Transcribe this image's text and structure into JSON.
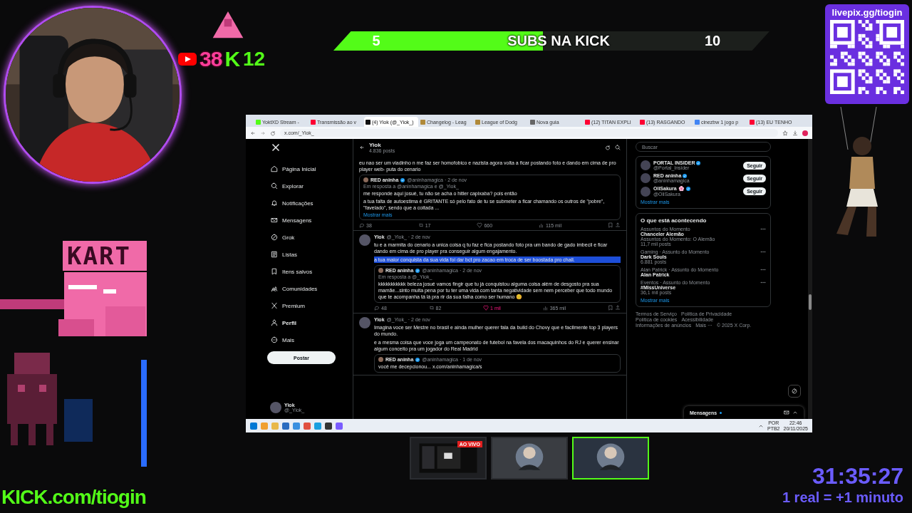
{
  "stream_overlay": {
    "youtube_counter": {
      "count": "38",
      "suffix": "K",
      "delta": "12"
    },
    "sub_goal": {
      "current": "5",
      "label": "SUBS NA KICK",
      "target": "10",
      "level": 0.48
    },
    "donation": {
      "url": "livepix.gg/tiogin"
    },
    "sign": "KART",
    "channel_url": "KICK.com/tiogin",
    "timer": "31:35:27",
    "timer_rule": "1 real = +1 minuto",
    "scenes": [
      {
        "kind": "screen",
        "badge": "AO VIVO",
        "selected": false
      },
      {
        "kind": "avatar",
        "selected": false
      },
      {
        "kind": "avatar",
        "selected": true
      }
    ]
  },
  "browser": {
    "tabs": [
      {
        "kind": "kick",
        "title": "YoktXD Stream -",
        "selected": false
      },
      {
        "kind": "youtube",
        "title": "Transmissão ao v",
        "selected": false
      },
      {
        "kind": "x",
        "title": "(4) Yiok (@_Yiok_)",
        "selected": true
      },
      {
        "kind": "game",
        "title": "Changelog - Leag",
        "selected": false
      },
      {
        "kind": "game",
        "title": "League of Dodg",
        "selected": false
      },
      {
        "kind": "globe",
        "title": "Nova guia",
        "selected": false
      },
      {
        "kind": "youtube",
        "title": "(12) TITAN EXPLI",
        "selected": false
      },
      {
        "kind": "youtube",
        "title": "(13) RASGANDO",
        "selected": false
      },
      {
        "kind": "google",
        "title": "cinezbw 1 jogo p",
        "selected": false
      },
      {
        "kind": "youtube",
        "title": "(13) EU TENHO",
        "selected": false
      }
    ],
    "address": "x.com/_Yiok_",
    "nav": [
      {
        "kind": "home",
        "label": "Página Inicial",
        "selected": false
      },
      {
        "kind": "search",
        "label": "Explorar",
        "selected": false
      },
      {
        "kind": "bell",
        "label": "Notificações",
        "selected": false
      },
      {
        "kind": "mail",
        "label": "Mensagens",
        "selected": false
      },
      {
        "kind": "grok",
        "label": "Grok",
        "selected": false
      },
      {
        "kind": "list",
        "label": "Listas",
        "selected": false
      },
      {
        "kind": "bookmark",
        "label": "Itens salvos",
        "selected": false
      },
      {
        "kind": "people",
        "label": "Comunidades",
        "selected": false
      },
      {
        "kind": "x",
        "label": "Premium",
        "selected": false
      },
      {
        "kind": "person",
        "label": "Perfil",
        "selected": true
      },
      {
        "kind": "more",
        "label": "Mais",
        "selected": false
      }
    ],
    "post_button": "Postar",
    "account": {
      "name": "Yiok",
      "handle": "@_Yiok_"
    },
    "profile_header": {
      "name": "Yiok",
      "posts": "4.836 posts"
    },
    "tweets": [
      {
        "paragraphs": [
          "eu nao ser um viadinho n me faz ser homofobico e nazista agora volta a ficar postando foto e dando em cima de pro player web- puta do cenario"
        ],
        "quote": {
          "author": "RED aninha",
          "meta": "@aninhamagica · 2 de nov",
          "reply_to": "Em resposta a @aninhamagica e @_Yiok_",
          "paragraphs": [
            "me responde aqui josué, tu não se acha o hitler capixaba? pois então",
            "a tua falta de autoestima é GRITANTE só pelo fato de tu se submeter a ficar chamando os outros de \"pobre\", \"favelado\", sendo que a coitada ..."
          ],
          "more": "Mostrar mais"
        },
        "stats": {
          "replies": "38",
          "reposts": "17",
          "likes": "660",
          "views": "115 mil",
          "liked": false
        }
      },
      {
        "author": "Yiok",
        "meta": "@_Yiok_ · 2 de nov",
        "paragraphs": [
          "tu e a marmita do cenario a unica coisa q tu faz e fica postando foto pra um bando de gado imbecil e ficar dando em cima de pro player pra conseguir algum engajamento.",
          "a tua maior conquista da sua vida foi dar  bct pro zacao em troca de ser boostada pro chall."
        ],
        "quote": {
          "author": "RED aninha",
          "meta": "@aninhamagica · 2 de nov",
          "reply_to": "Em resposta a @_Yiok_",
          "paragraphs": [
            "kkkkkkkkkkk beleza josué vamos fingir que tu já conquistou alguma coisa além de desgosto pra sua mamãe...sinto muita pena por tu ter uma vida com tanta negatividade sem nem perceber que todo mundo que te acompanha tá lá pra rir da sua falha como ser humano 😊"
          ]
        },
        "stats": {
          "replies": "48",
          "reposts": "82",
          "likes": "1 mil",
          "views": "365 mil",
          "liked": true
        }
      },
      {
        "author": "Yiok",
        "meta": "@_Yiok_ · 2 de nov",
        "paragraphs": [
          "Imagina voce ser Mestre no brasil e ainda mulher querer fala da build do Chovy que e facilmente top 3 players do mundo.",
          "e a mesma coisa que voce joga um campeonato de futebol na favela dos macaquinhos do RJ e querer ensinar algum conceito pra um jogador do Real Madrid"
        ],
        "quote": {
          "author": "RED aninha",
          "meta": "@aninhamagica · 1 de nov",
          "paragraphs": [
            "você me decepcionou... x.com/aninhamagica/s"
          ]
        }
      }
    ],
    "search": {
      "placeholder": "Buscar"
    },
    "follow": [
      {
        "name": "PORTAL INSIDER",
        "handle": "@Portal_Insider",
        "button": "Seguir"
      },
      {
        "name": "RED aninha",
        "handle": "@aninhamagica",
        "button": "Seguir"
      },
      {
        "name": "OliSakura 🌸",
        "handle": "@OliSakura",
        "button": "Seguir"
      }
    ],
    "follow_more": "Mostrar mais",
    "trends_title": "O que está acontecendo",
    "trends": [
      {
        "context": "Assuntos do Momento",
        "topic": "Chanceler Alemão",
        "extra": "Assuntos do Momento: O Alemão",
        "posts": "11,7 mil posts"
      },
      {
        "context": "Gaming · Assunto do Momento",
        "topic": "Dark Souls",
        "posts": "6.881 posts"
      },
      {
        "context": "Alan Patrick · Assunto do Momento",
        "topic": "Alan Patrick"
      },
      {
        "context": "Eventos · Assunto do Momento",
        "topic": "#MissUniverse",
        "posts": "36,1 mil posts"
      }
    ],
    "trends_more": "Mostrar mais",
    "footer_links": [
      "Termos de Serviço",
      "Política de Privacidade",
      "Política de cookies",
      "Acessibilidade",
      "Informações de anúncios",
      "Mais ···",
      "© 2025 X Corp."
    ],
    "messages": "Mensagens"
  },
  "taskbar": {
    "language": "POR",
    "layout": "PTB2",
    "time": "22:46",
    "date": "20/11/2025"
  }
}
